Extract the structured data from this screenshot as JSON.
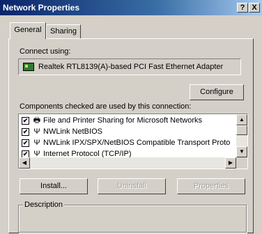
{
  "window": {
    "title": "Network Properties",
    "help": "?",
    "close": "X"
  },
  "tabs": [
    {
      "label": "General"
    },
    {
      "label": "Sharing"
    }
  ],
  "connect_using_label": "Connect using:",
  "adapter": {
    "name": "Realtek RTL8139(A)-based PCI Fast Ethernet Adapter"
  },
  "buttons": {
    "configure": "Configure",
    "install": "Install...",
    "uninstall": "Uninstall",
    "properties": "Properties"
  },
  "components_label": "Components checked are used by this connection:",
  "components": [
    {
      "label": "File and Printer Sharing for Microsoft Networks",
      "checked": "✔"
    },
    {
      "label": "NWLink NetBIOS",
      "checked": "✔"
    },
    {
      "label": "NWLink IPX/SPX/NetBIOS Compatible Transport Proto",
      "checked": "✔"
    },
    {
      "label": "Internet Protocol (TCP/IP)",
      "checked": "✔"
    }
  ],
  "description_label": "Description"
}
